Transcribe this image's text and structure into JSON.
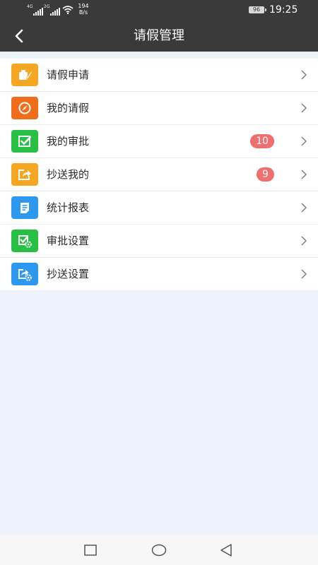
{
  "status_bar": {
    "network1": "4G",
    "network2": "2G",
    "speed_value": "194",
    "speed_unit": "B/s",
    "battery": "96",
    "time": "19:25"
  },
  "header": {
    "title": "请假管理",
    "back_icon": "chevron-left-icon"
  },
  "menu": {
    "items": [
      {
        "label": "请假申请",
        "icon": "apply-leave-icon",
        "color": "#f5a623",
        "badge": null
      },
      {
        "label": "我的请假",
        "icon": "compass-icon",
        "color": "#f06e1b",
        "badge": null
      },
      {
        "label": "我的审批",
        "icon": "checkbox-icon",
        "color": "#28c044",
        "badge": "10"
      },
      {
        "label": "抄送我的",
        "icon": "share-icon",
        "color": "#f5a623",
        "badge": "9"
      },
      {
        "label": "统计报表",
        "icon": "report-icon",
        "color": "#2d98f0",
        "badge": null
      },
      {
        "label": "审批设置",
        "icon": "approval-settings-icon",
        "color": "#28c044",
        "badge": null
      },
      {
        "label": "抄送设置",
        "icon": "cc-settings-icon",
        "color": "#2d98f0",
        "badge": null
      }
    ]
  },
  "colors": {
    "header_bg": "#3a3a3a",
    "page_bg": "#eef3fb",
    "badge_bg": "#ef6e6e"
  },
  "system_nav": [
    "recent-apps-icon",
    "home-icon",
    "back-triangle-icon"
  ]
}
